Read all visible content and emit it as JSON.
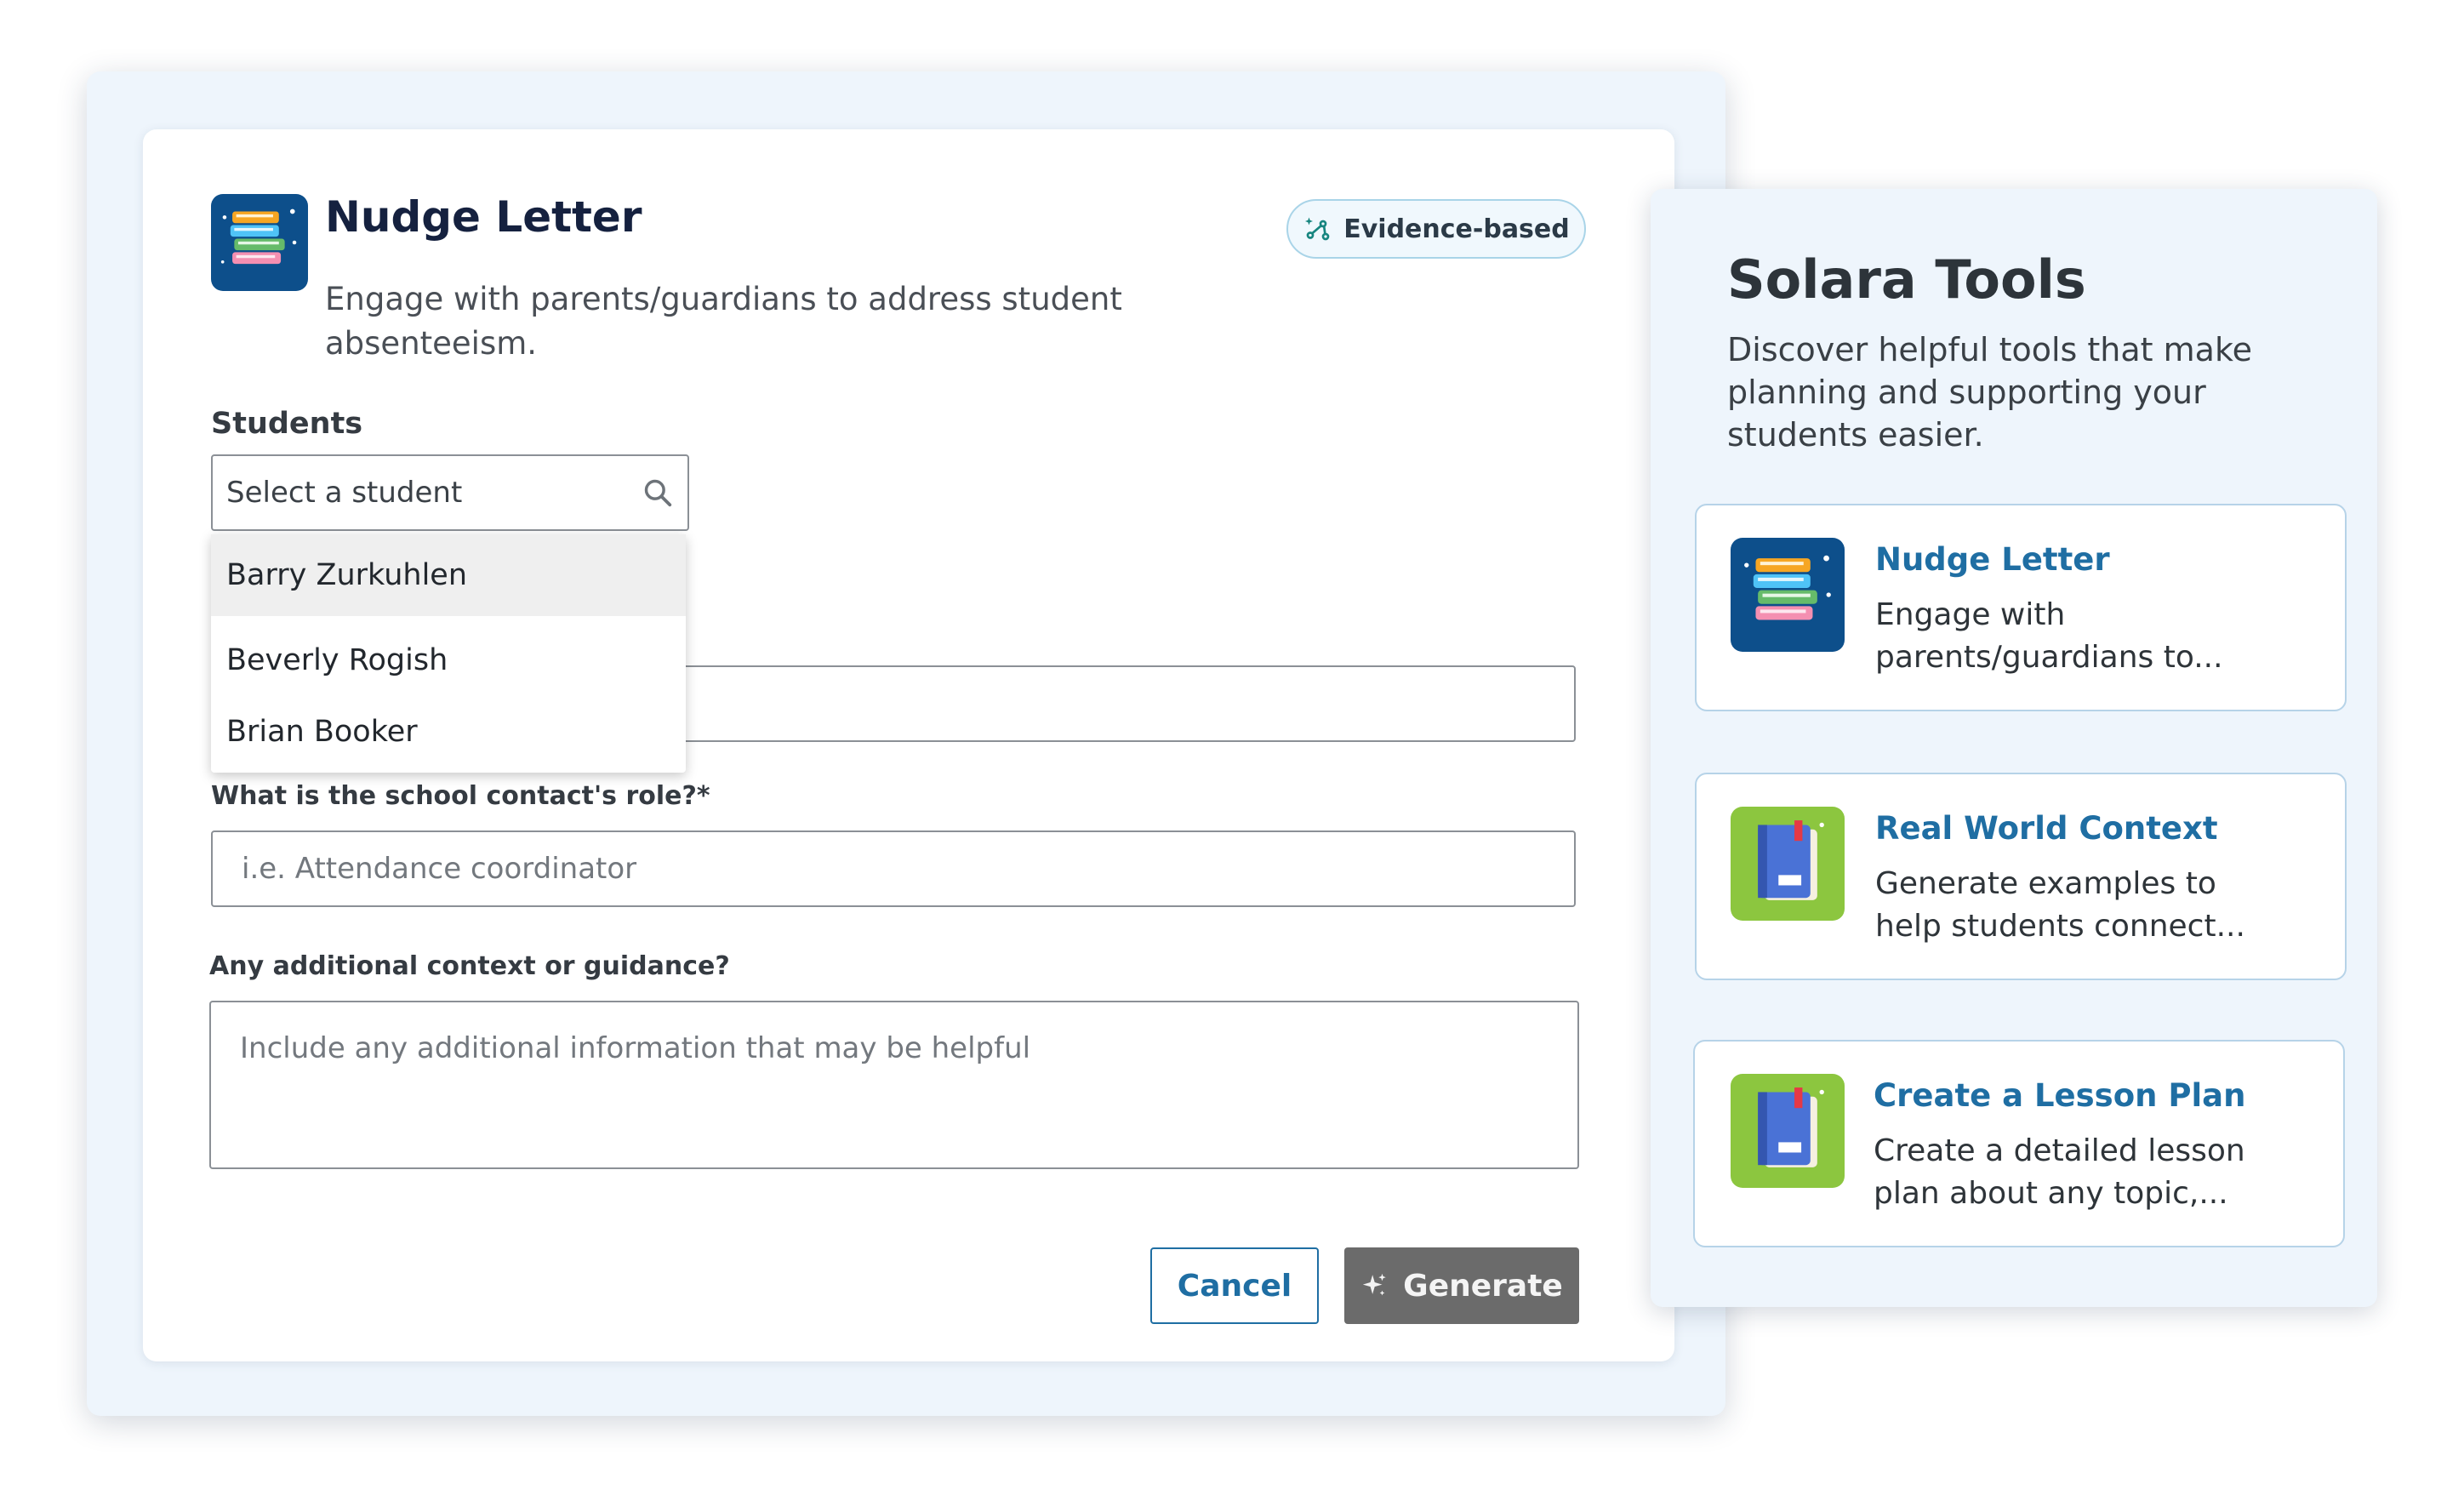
{
  "form": {
    "title": "Nudge Letter",
    "description": "Engage with parents/guardians to address student absenteeism.",
    "badge": "Evidence-based",
    "students_label": "Students",
    "student_select_placeholder": "Select a student",
    "student_options": [
      "Barry Zurkuhlen",
      "Beverly Rogish",
      "Brian Booker"
    ],
    "role_label": "What is the school contact's role?*",
    "role_placeholder": "i.e. Attendance coordinator",
    "context_label": "Any additional context or guidance?",
    "context_placeholder": "Include any additional information that may be helpful",
    "cancel_label": "Cancel",
    "generate_label": "Generate"
  },
  "tools_panel": {
    "title": "Solara Tools",
    "subtitle": "Discover helpful tools that make planning and supporting your students easier.",
    "tools": [
      {
        "title": "Nudge Letter",
        "description": "Engage with parents/guardians to...",
        "icon": "books-stack-icon"
      },
      {
        "title": "Real World Context",
        "description": "Generate examples to help students connect...",
        "icon": "notebook-icon"
      },
      {
        "title": "Create a Lesson Plan",
        "description": "Create a detailed lesson plan about any topic,...",
        "icon": "notebook-icon"
      }
    ]
  },
  "colors": {
    "primary_blue": "#1f6ea3",
    "books_icon_bg": "#0d4f8b",
    "notebook_icon_bg": "#8cc63f",
    "disabled_button": "#6b6b6b"
  }
}
